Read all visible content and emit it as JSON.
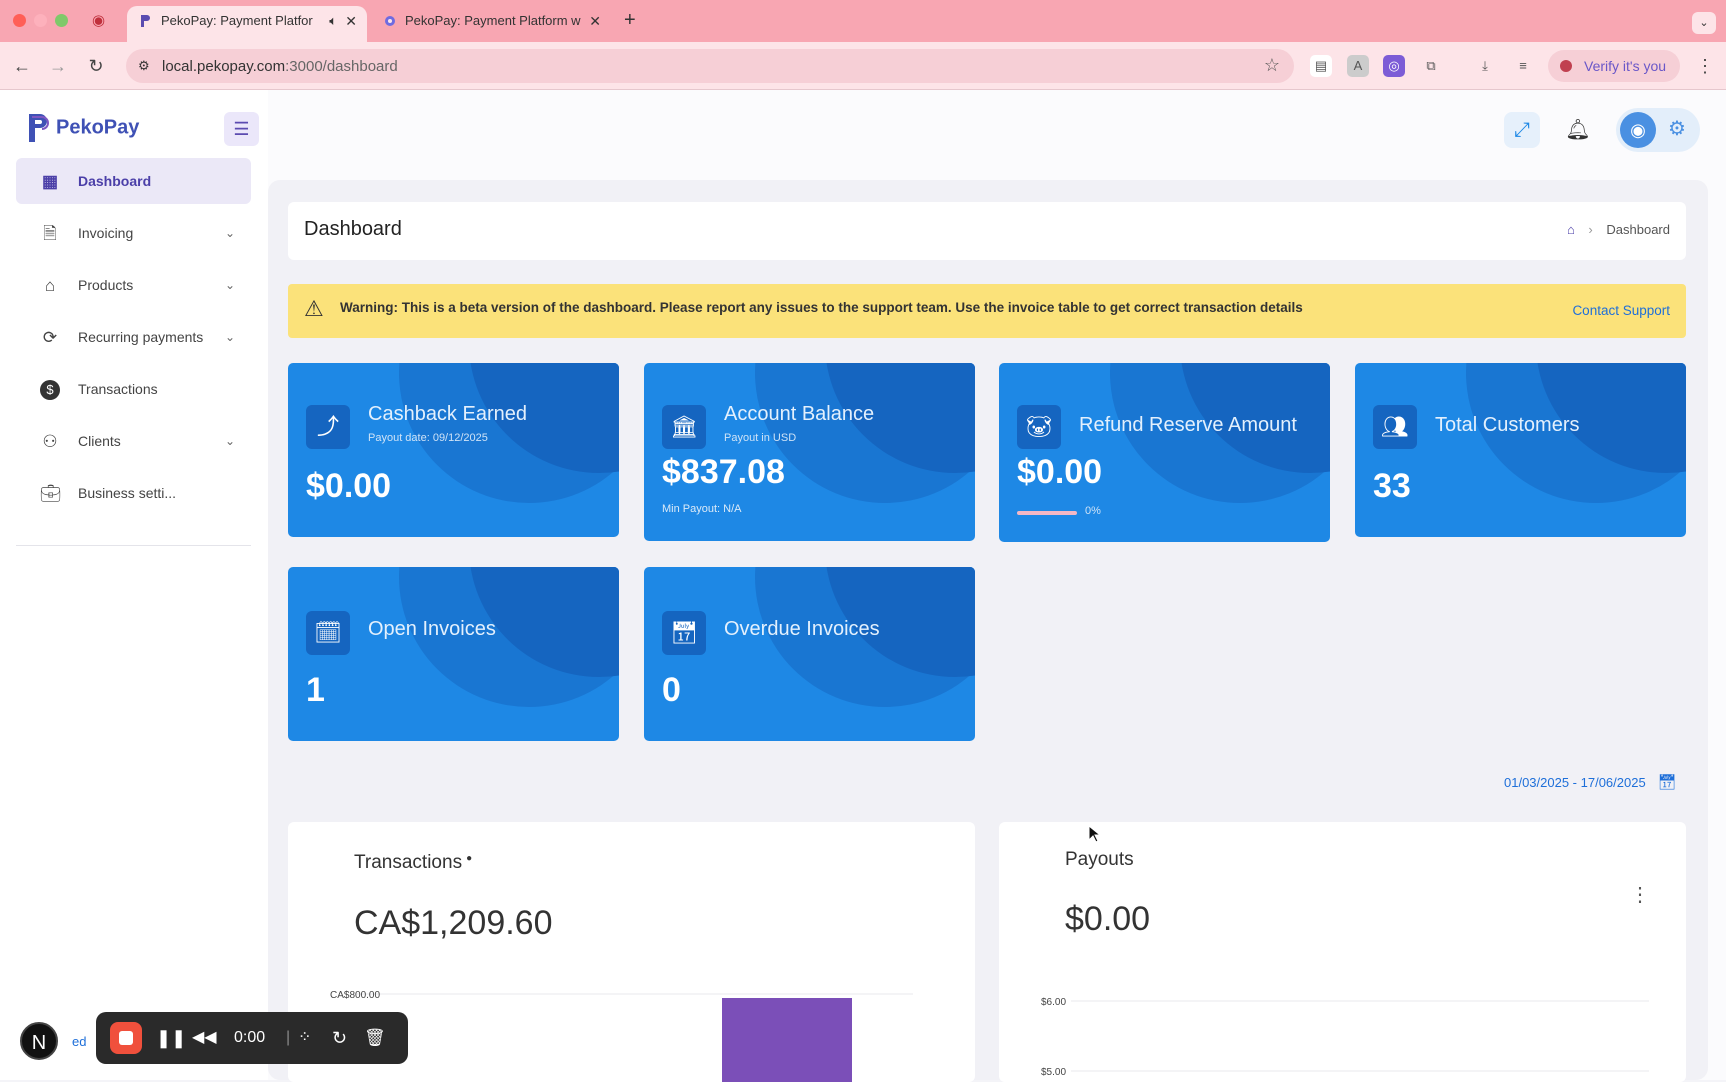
{
  "browser": {
    "tabs": [
      {
        "title": "PekoPay: Payment Platfor",
        "active": true
      },
      {
        "title": "PekoPay: Payment Platform w",
        "active": false
      }
    ],
    "url_host": "local.pekopay.com",
    "url_path": ":3000/dashboard",
    "profile_label": "Verify it's you"
  },
  "sidebar": {
    "brand": "PekoPay",
    "items": [
      {
        "label": "Dashboard",
        "icon": "grid-icon",
        "active": true
      },
      {
        "label": "Invoicing",
        "icon": "document-icon",
        "chevron": true
      },
      {
        "label": "Products",
        "icon": "store-icon",
        "chevron": true
      },
      {
        "label": "Recurring payments",
        "icon": "refresh-icon",
        "chevron": true
      },
      {
        "label": "Transactions",
        "icon": "dollar-icon"
      },
      {
        "label": "Clients",
        "icon": "people-icon",
        "chevron": true
      },
      {
        "label": "Business setti...",
        "icon": "briefcase-icon"
      }
    ],
    "partial_label": "ed"
  },
  "page": {
    "title": "Dashboard",
    "breadcrumb_current": "Dashboard"
  },
  "warning": {
    "text": "Warning: This is a beta version of the dashboard. Please report any issues to the support team. Use the invoice table to get correct transaction details",
    "link": "Contact Support"
  },
  "cards": {
    "cashback": {
      "title": "Cashback Earned",
      "subtitle": "Payout date: 09/12/2025",
      "value": "$0.00"
    },
    "balance": {
      "title": "Account Balance",
      "subtitle": "Payout in USD",
      "value": "$837.08",
      "min": "Min Payout: N/A"
    },
    "refund": {
      "title": "Refund Reserve Amount",
      "value": "$0.00",
      "progress_label": "0%",
      "progress": 0
    },
    "customers": {
      "title": "Total Customers",
      "value": "33"
    },
    "open_invoices": {
      "title": "Open Invoices",
      "value": "1"
    },
    "overdue_invoices": {
      "title": "Overdue Invoices",
      "value": "0"
    }
  },
  "date_range": "01/03/2025 - 17/06/2025",
  "transactions": {
    "title": "Transactions",
    "total": "CA$1,209.60"
  },
  "payouts": {
    "title": "Payouts",
    "total": "$0.00"
  },
  "chart_data": [
    {
      "type": "bar",
      "title": "Transactions",
      "ytick_labels": [
        "CA$800.00"
      ],
      "bar_color": "#7b4fb8"
    },
    {
      "type": "line",
      "title": "Payouts",
      "ytick_labels": [
        "$6.00",
        "$5.00"
      ]
    }
  ],
  "recorder": {
    "time": "0:00"
  },
  "colors": {
    "accent": "#4b3fa8",
    "card_blue": "#1e88e5",
    "warning_bg": "#fbe27a",
    "link": "#1e6fd9"
  }
}
